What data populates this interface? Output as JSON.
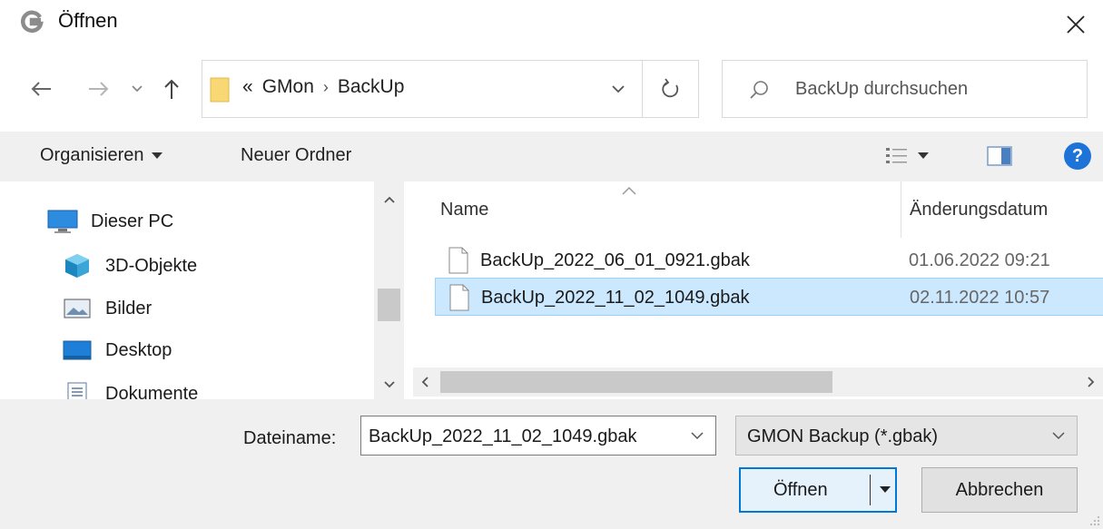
{
  "window": {
    "title": "Öffnen",
    "app_icon": "gmon-logo",
    "close_icon": "close-icon"
  },
  "navigation": {
    "back_icon": "arrow-left-icon",
    "forward_icon": "arrow-right-icon",
    "recent_icon": "chevron-down-icon",
    "up_icon": "arrow-up-icon",
    "address": {
      "overflow": "«",
      "crumbs": [
        "GMon",
        "BackUp"
      ],
      "separator": "›"
    },
    "refresh_icon": "refresh-icon",
    "search_placeholder": "BackUp durchsuchen"
  },
  "toolbar": {
    "organize_label": "Organisieren",
    "new_folder_label": "Neuer Ordner",
    "help_label": "?"
  },
  "nav_pane": {
    "items": [
      {
        "label": "Dieser PC",
        "icon": "computer-icon"
      },
      {
        "label": "3D-Objekte",
        "icon": "cube-3d-icon"
      },
      {
        "label": "Bilder",
        "icon": "pictures-icon"
      },
      {
        "label": "Desktop",
        "icon": "desktop-icon"
      },
      {
        "label": "Dokumente",
        "icon": "documents-icon"
      }
    ]
  },
  "file_list": {
    "columns": {
      "name": "Name",
      "date": "Änderungsdatum"
    },
    "files": [
      {
        "name": "BackUp_2022_06_01_0921.gbak",
        "date": "01.06.2022 09:21",
        "selected": false
      },
      {
        "name": "BackUp_2022_11_02_1049.gbak",
        "date": "02.11.2022 10:57",
        "selected": true
      }
    ]
  },
  "footer": {
    "filename_label": "Dateiname:",
    "filename_value": "BackUp_2022_11_02_1049.gbak",
    "filetype_value": "GMON Backup (*.gbak)",
    "open_label": "Öffnen",
    "cancel_label": "Abbrechen"
  },
  "colors": {
    "selection": "#cce8ff",
    "accent": "#0078d7",
    "help": "#1e73d9",
    "folder": "#f8d775"
  }
}
